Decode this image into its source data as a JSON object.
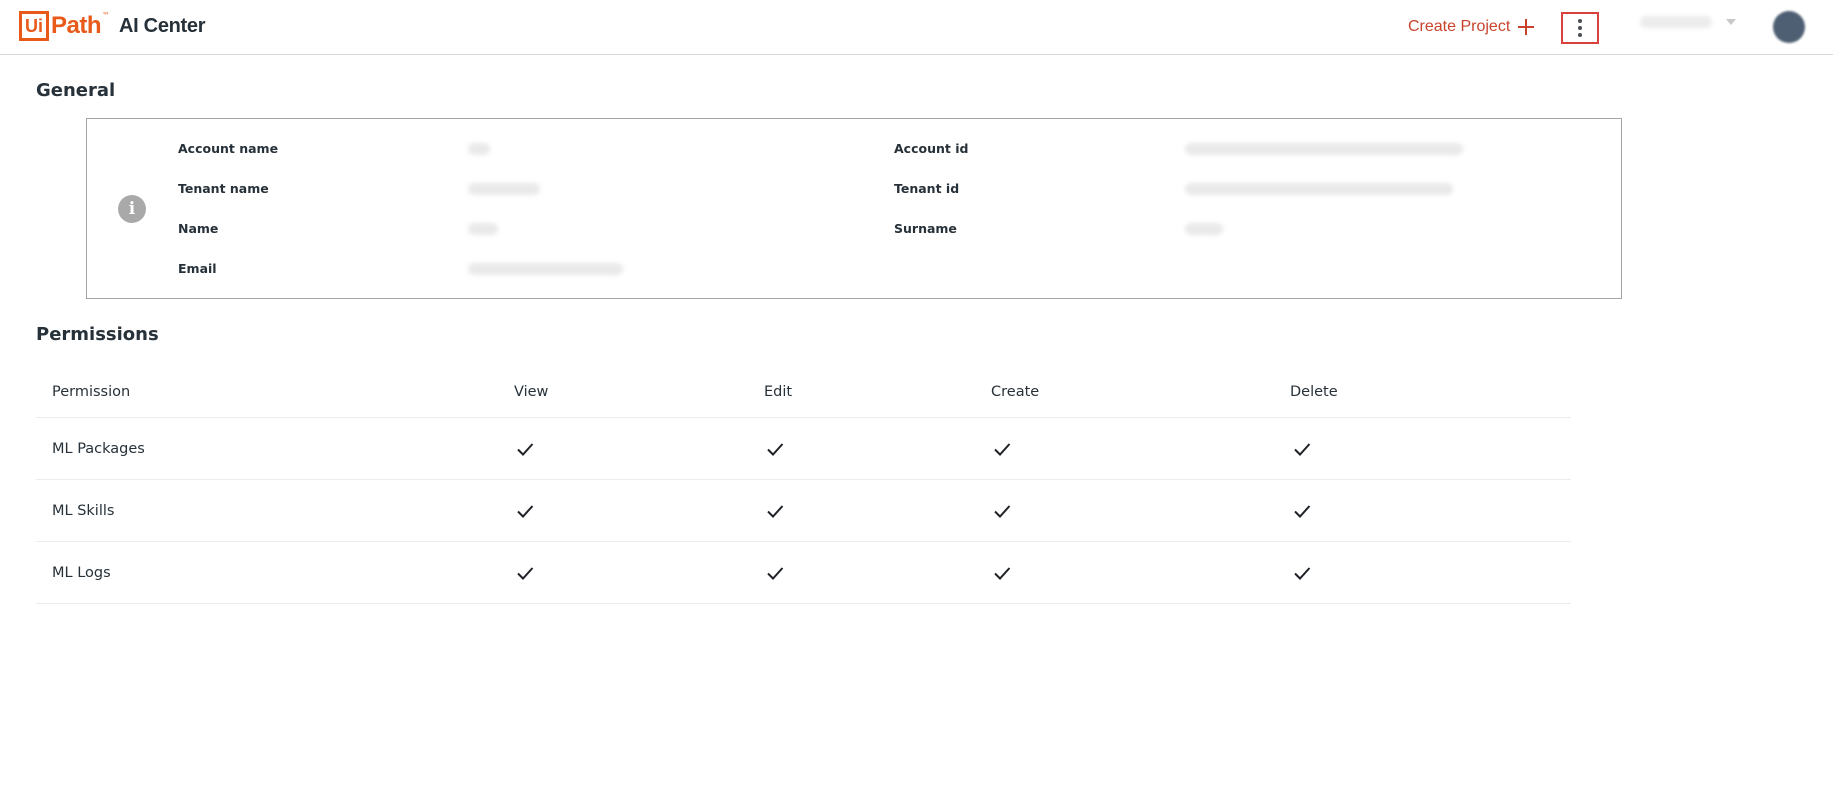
{
  "header": {
    "brand_prefix": "Ui",
    "brand_suffix": "Path",
    "brand_tm": "™",
    "product_name": "AI Center",
    "create_project_label": "Create Project",
    "icons": [
      "plus-icon",
      "more-vertical-icon",
      "chevron-down-icon",
      "avatar"
    ],
    "accent_color": "#e8591a"
  },
  "general": {
    "title": "General",
    "fields": {
      "account_name_label": "Account name",
      "tenant_name_label": "Tenant name",
      "name_label": "Name",
      "email_label": "Email",
      "account_id_label": "Account id",
      "tenant_id_label": "Tenant id",
      "surname_label": "Surname"
    }
  },
  "permissions": {
    "title": "Permissions",
    "columns": [
      "Permission",
      "View",
      "Edit",
      "Create",
      "Delete"
    ],
    "rows": [
      {
        "name": "ML Packages",
        "view": true,
        "edit": true,
        "create": true,
        "delete": true
      },
      {
        "name": "ML Skills",
        "view": true,
        "edit": true,
        "create": true,
        "delete": true
      },
      {
        "name": "ML Logs",
        "view": true,
        "edit": true,
        "create": true,
        "delete": true
      }
    ]
  }
}
